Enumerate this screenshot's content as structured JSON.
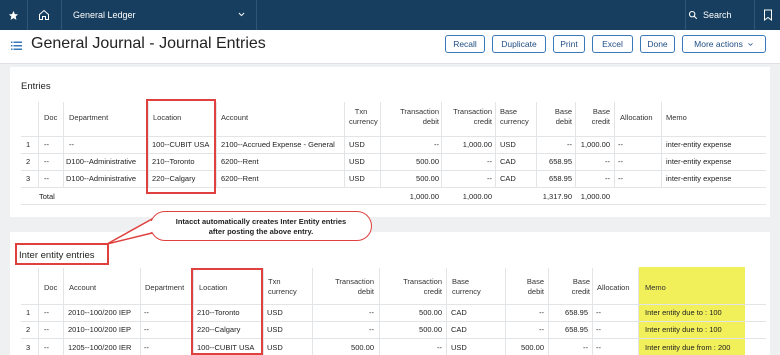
{
  "topbar": {
    "title": "General Ledger",
    "search_label": "Search"
  },
  "page": {
    "title": "General Journal - Journal Entries"
  },
  "toolbar": {
    "recall": "Recall",
    "duplicate": "Duplicate",
    "print": "Print",
    "excel": "Excel",
    "done": "Done",
    "more": "More actions"
  },
  "entries": {
    "title": "Entries",
    "headers": {
      "doc": "Doc",
      "department": "Department",
      "location": "Location",
      "account": "Account",
      "txn_currency": "Txn\ncurrency",
      "txn_debit": "Transaction\ndebit",
      "txn_credit": "Transaction\ncredit",
      "base_currency": "Base\ncurrency",
      "base_debit": "Base\ndebit",
      "base_credit": "Base\ncredit",
      "allocation": "Allocation",
      "memo": "Memo"
    },
    "rows": [
      {
        "n": "1",
        "doc": "--",
        "department": "--",
        "location": "100--CUBIT USA",
        "account": "2100--Accrued Expense - General",
        "txn_currency": "USD",
        "txn_debit": "--",
        "txn_credit": "1,000.00",
        "base_currency": "USD",
        "base_debit": "--",
        "base_credit": "1,000.00",
        "allocation": "--",
        "memo": "inter-entity expense"
      },
      {
        "n": "2",
        "doc": "--",
        "department": "D100--Administrative",
        "location": "210--Toronto",
        "account": "6200--Rent",
        "txn_currency": "USD",
        "txn_debit": "500.00",
        "txn_credit": "--",
        "base_currency": "CAD",
        "base_debit": "658.95",
        "base_credit": "--",
        "allocation": "--",
        "memo": "inter-entity expense"
      },
      {
        "n": "3",
        "doc": "--",
        "department": "D100--Administrative",
        "location": "220--Calgary",
        "account": "6200--Rent",
        "txn_currency": "USD",
        "txn_debit": "500.00",
        "txn_credit": "--",
        "base_currency": "CAD",
        "base_debit": "658.95",
        "base_credit": "--",
        "allocation": "--",
        "memo": "inter-entity expense"
      }
    ],
    "total": {
      "label": "Total",
      "txn_debit": "1,000.00",
      "txn_credit": "1,000.00",
      "base_debit": "1,317.90",
      "base_credit": "1,000.00"
    }
  },
  "callout": {
    "line1": "Intacct automatically creates Inter Entity entries",
    "line2": "after posting the above entry."
  },
  "inter": {
    "title": "Inter entity entries",
    "headers": {
      "doc": "Doc",
      "account": "Account",
      "department": "Department",
      "location": "Location",
      "txn_currency": "Txn\ncurrency",
      "txn_debit": "Transaction\ndebit",
      "txn_credit": "Transaction\ncredit",
      "base_currency": "Base\ncurrency",
      "base_debit": "Base\ndebit",
      "base_credit": "Base\ncredit",
      "allocation": "Allocation",
      "memo": "Memo"
    },
    "rows": [
      {
        "n": "1",
        "doc": "--",
        "account": "2010--100/200 IEP",
        "department": "--",
        "location": "210--Toronto",
        "txn_currency": "USD",
        "txn_debit": "--",
        "txn_credit": "500.00",
        "base_currency": "CAD",
        "base_debit": "--",
        "base_credit": "658.95",
        "allocation": "--",
        "memo": "Inter entity due to : 100"
      },
      {
        "n": "2",
        "doc": "--",
        "account": "2010--100/200 IEP",
        "department": "--",
        "location": "220--Calgary",
        "txn_currency": "USD",
        "txn_debit": "--",
        "txn_credit": "500.00",
        "base_currency": "CAD",
        "base_debit": "--",
        "base_credit": "658.95",
        "allocation": "--",
        "memo": "Inter entity due to : 100"
      },
      {
        "n": "3",
        "doc": "--",
        "account": "1205--100/200 IER",
        "department": "--",
        "location": "100--CUBIT USA",
        "txn_currency": "USD",
        "txn_debit": "500.00",
        "txn_credit": "--",
        "base_currency": "USD",
        "base_debit": "500.00",
        "base_credit": "--",
        "allocation": "--",
        "memo": "Inter entity due from : 200"
      }
    ]
  },
  "colors": {
    "topbar": "#173e5e",
    "accent": "#3a79b9",
    "highlight": "#e0413f",
    "memo_highlight": "#f1ef5a"
  },
  "icons": [
    "star-icon",
    "home-icon",
    "chevron-down-icon",
    "search-icon",
    "bookmark-icon",
    "hamburger-icon"
  ]
}
